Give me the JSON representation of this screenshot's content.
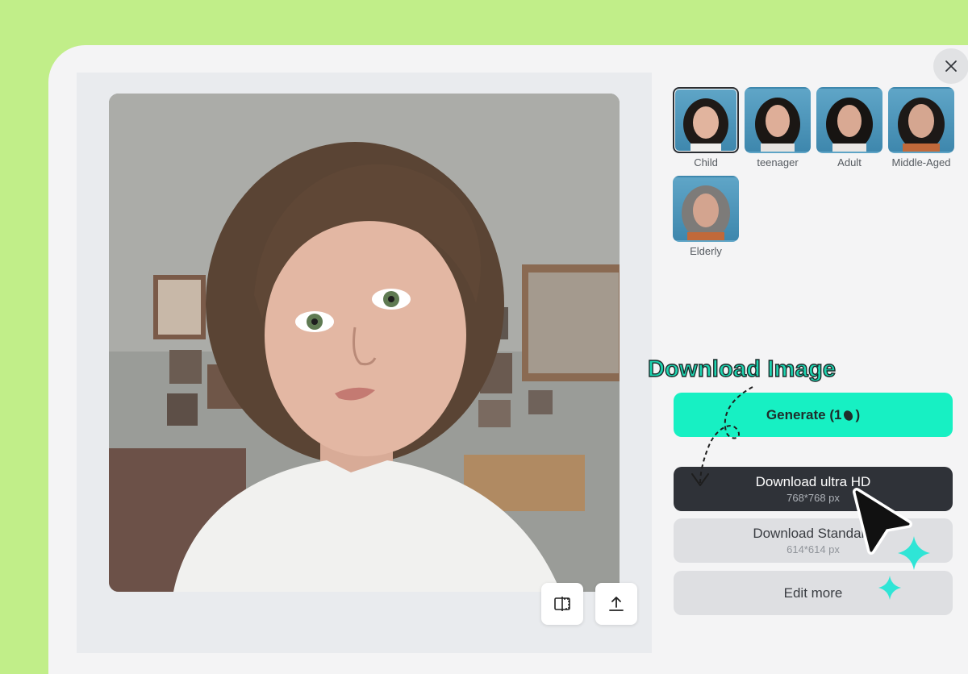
{
  "dialog": {
    "close_icon": "close-icon"
  },
  "preview": {
    "compare_icon": "compare-icon",
    "share_icon": "share-upload-icon"
  },
  "age_options": [
    {
      "label": "Child",
      "selected": true
    },
    {
      "label": "teenager",
      "selected": false
    },
    {
      "label": "Adult",
      "selected": false
    },
    {
      "label": "Middle-Aged",
      "selected": false
    },
    {
      "label": "Elderly",
      "selected": false
    }
  ],
  "annotation": {
    "label": "Download Image"
  },
  "actions": {
    "generate": {
      "label": "Generate (1",
      "suffix": ")",
      "icon": "credit-coin-icon"
    },
    "download_uhd": {
      "label": "Download ultra HD",
      "size": "768*768 px"
    },
    "download_standard": {
      "label": "Download Standard",
      "size": "614*614 px"
    },
    "edit_more": {
      "label": "Edit more"
    }
  },
  "colors": {
    "background": "#c1ee89",
    "accent": "#17f0c3",
    "dark_button": "#2f3238",
    "annotation_text": "#1dd4b0"
  }
}
